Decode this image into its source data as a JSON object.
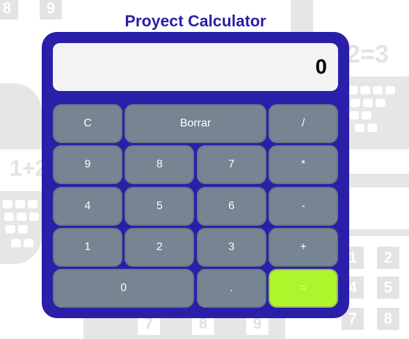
{
  "app": {
    "title": "Proyect Calculator"
  },
  "display": {
    "value": "0"
  },
  "keys": {
    "clear": "C",
    "borrar": "Borrar",
    "divide": "/",
    "nine": "9",
    "eight": "8",
    "seven": "7",
    "multiply": "*",
    "four": "4",
    "five": "5",
    "six": "6",
    "minus": "-",
    "one": "1",
    "two": "2",
    "three": "3",
    "plus": "+",
    "zero": "0",
    "dot": ".",
    "equals": "="
  },
  "background": {
    "top_left_digits": [
      "8",
      "9"
    ],
    "equation_right": "2=3",
    "equation_left": "1+2",
    "grid_bottom_right": [
      "1",
      "2",
      "4",
      "5",
      "7",
      "8"
    ],
    "bottom_digits": [
      "7",
      "8",
      "9"
    ]
  },
  "colors": {
    "brand": "#2a1fa8",
    "key": "#778491",
    "equals_key": "#aef52c",
    "display_bg": "#f3f3f3"
  }
}
